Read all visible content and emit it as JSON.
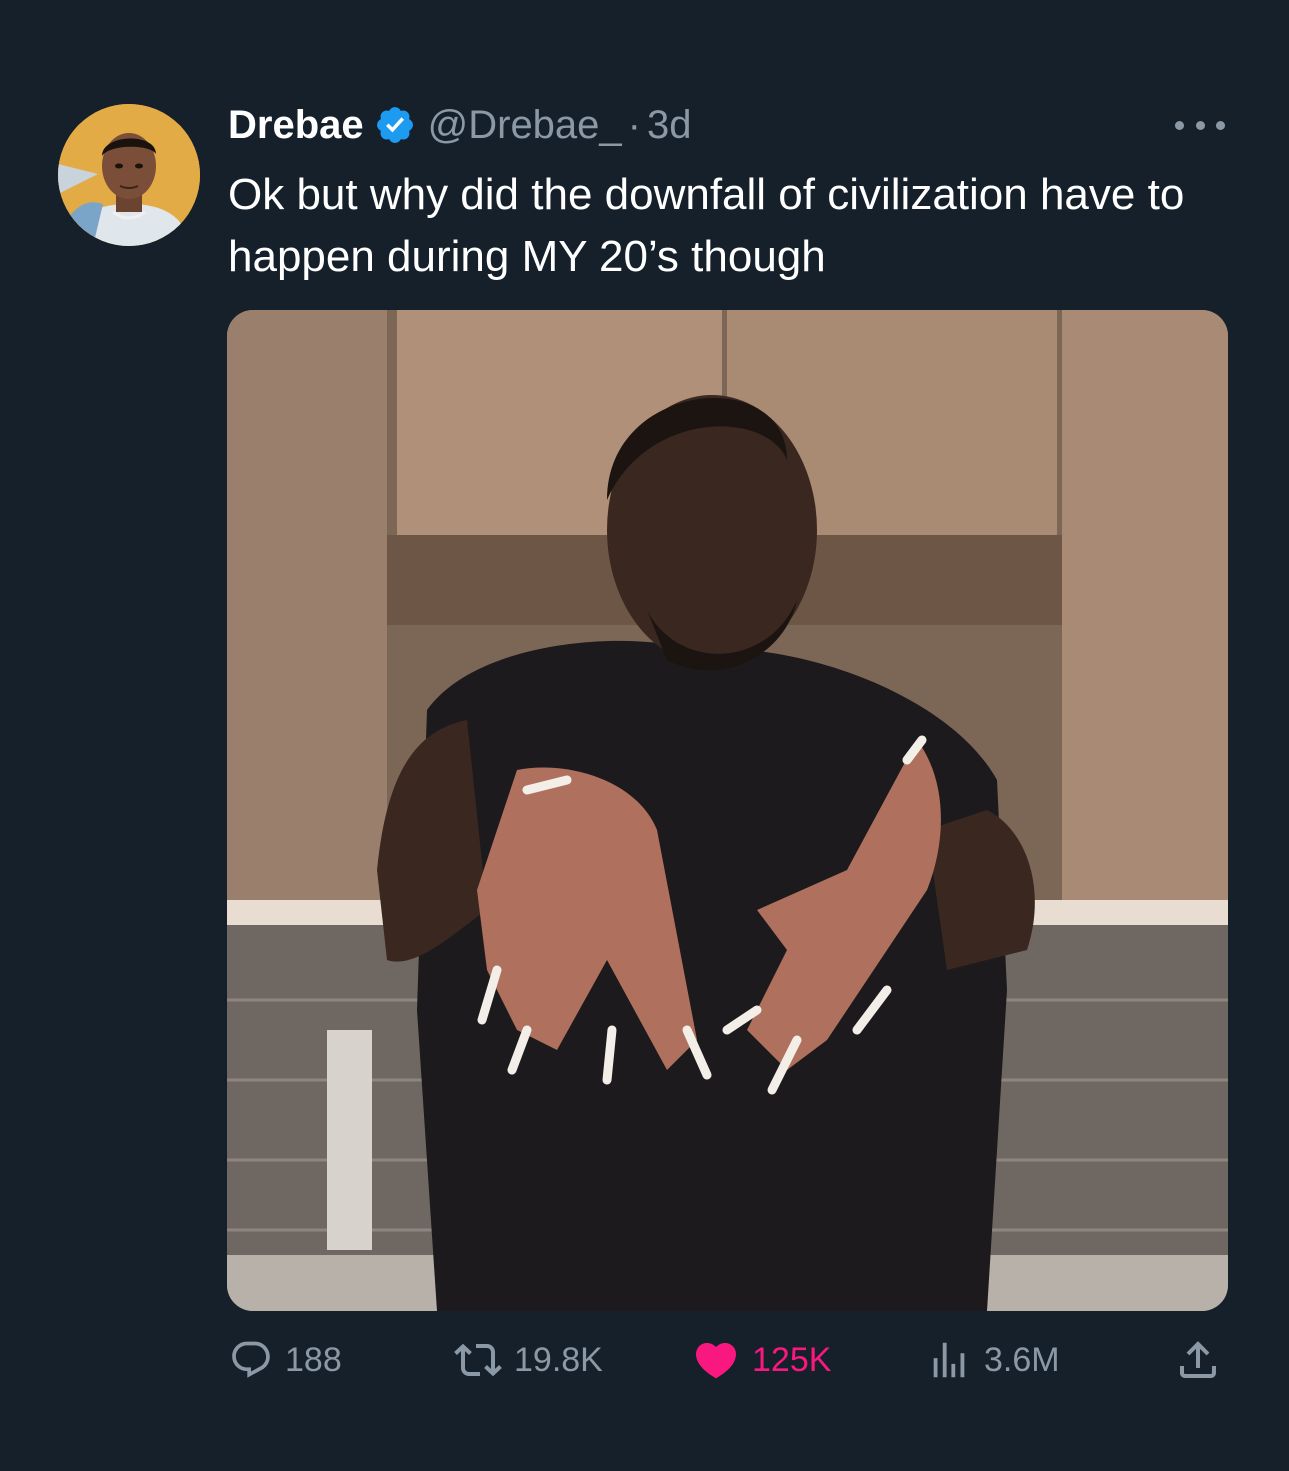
{
  "tweet": {
    "author": {
      "display_name": "Drebae",
      "handle": "@Drebae_",
      "verified": true,
      "avatar": "avatar-photo"
    },
    "separator": "·",
    "time": "3d",
    "text": "Ok but why did the downfall of civilization have to happen during MY 20’s though",
    "media": {
      "type": "photo",
      "icon": "photo"
    },
    "actions": {
      "reply": {
        "icon": "reply-icon",
        "count": "188"
      },
      "retweet": {
        "icon": "retweet-icon",
        "count": "19.8K"
      },
      "like": {
        "icon": "heart-icon",
        "count": "125K",
        "liked": true
      },
      "views": {
        "icon": "views-icon",
        "count": "3.6M"
      },
      "share": {
        "icon": "share-icon"
      }
    }
  },
  "colors": {
    "background": "#15202b",
    "secondary_text": "#8b98a5",
    "verified": "#1d9bf0",
    "like": "#f91880"
  }
}
